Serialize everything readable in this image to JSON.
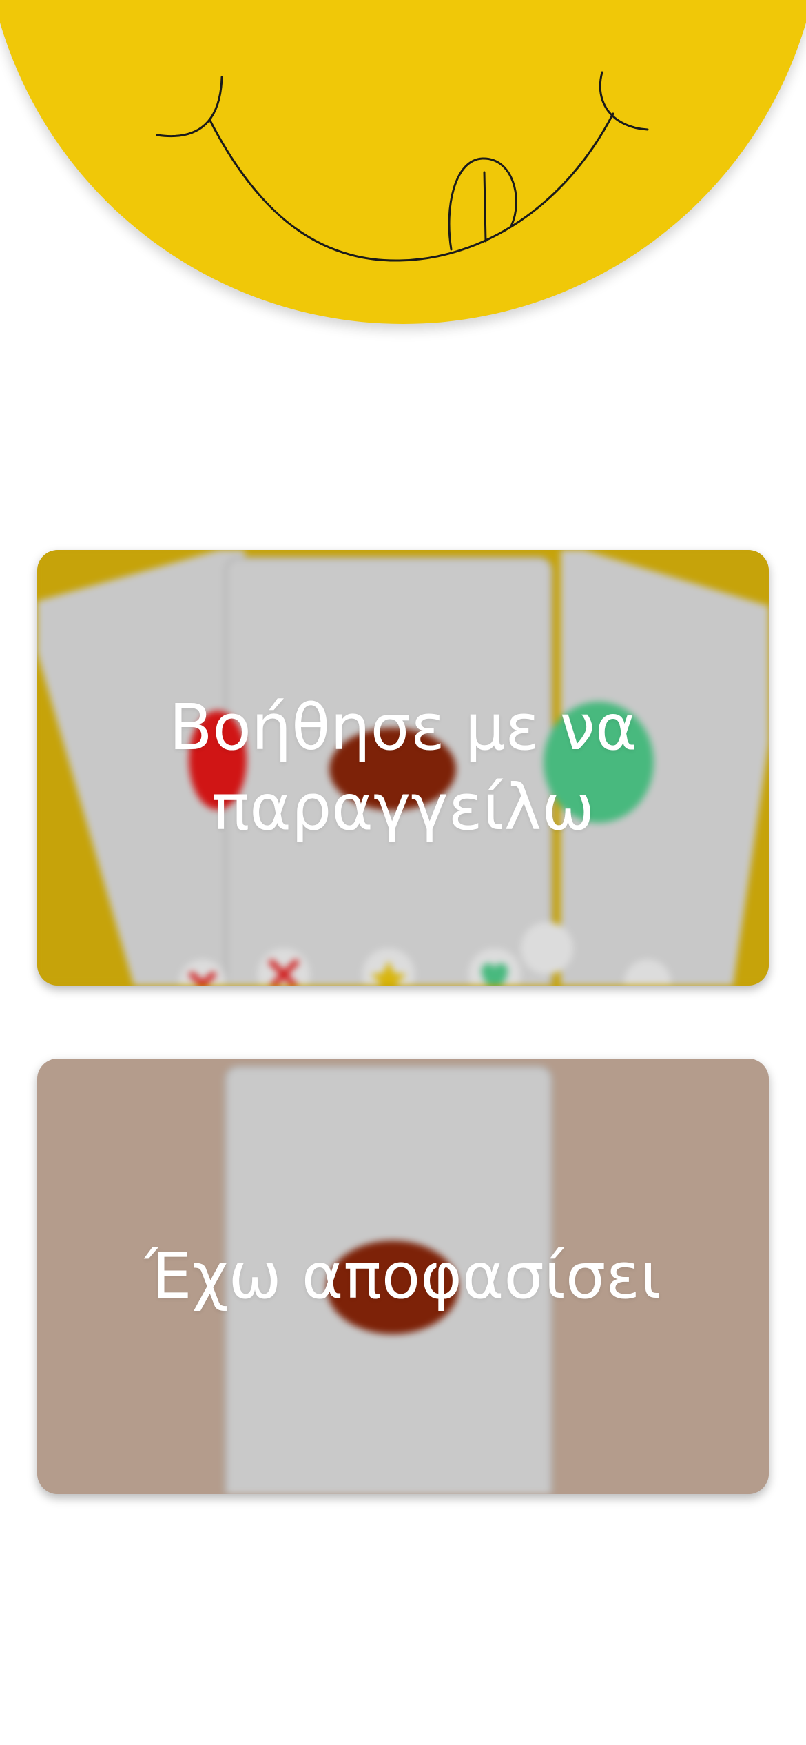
{
  "header": {
    "mascot_icon": "smiley-face-tongue-icon",
    "accent_color": "#f0c808"
  },
  "cards": [
    {
      "label": "Βοήθησε με να παραγγείλω",
      "background_color": "#c6a30a",
      "image_icon": "swipe-food-cards-icon"
    },
    {
      "label": "Έχω αποφασίσει",
      "background_color": "#b49c8c",
      "image_icon": "single-food-card-icon"
    }
  ]
}
